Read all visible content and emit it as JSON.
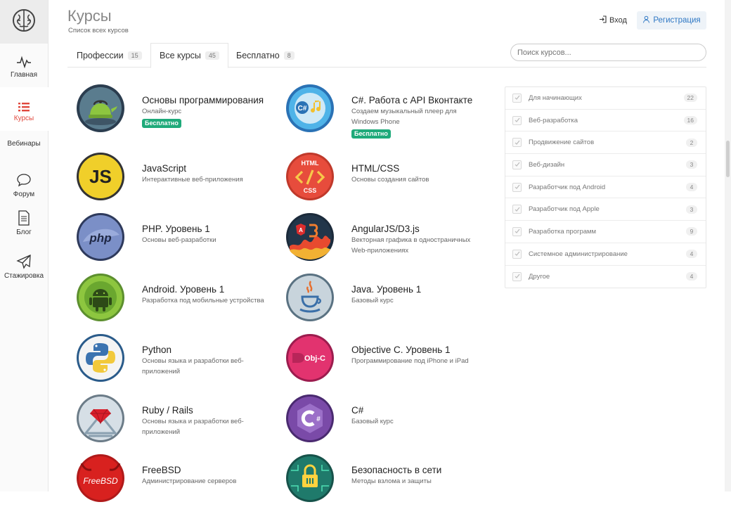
{
  "sidebar": {
    "logo_icon": "brain-icon",
    "items": [
      {
        "icon": "pulse-icon",
        "label": "Главная",
        "active": false
      },
      {
        "icon": "list-icon",
        "label": "Курсы",
        "active": true
      },
      {
        "icon": "",
        "label": "Вебинары",
        "active": false
      },
      {
        "icon": "chat-bubble-icon",
        "label": "Форум",
        "active": false
      },
      {
        "icon": "document-icon",
        "label": "Блог",
        "active": false
      },
      {
        "icon": "paper-plane-icon",
        "label": "Стажировка",
        "active": false
      }
    ]
  },
  "header": {
    "title": "Курсы",
    "subtitle": "Список всех курсов",
    "login_label": "Вход",
    "register_label": "Регистрация"
  },
  "tabs": [
    {
      "label": "Профессии",
      "count": "15",
      "active": false
    },
    {
      "label": "Все курсы",
      "count": "45",
      "active": true
    },
    {
      "label": "Бесплатно",
      "count": "8",
      "active": false
    }
  ],
  "search": {
    "placeholder": "Поиск курсов..."
  },
  "courses": [
    {
      "name": "Основы программирования",
      "desc": "Онлайн-курс",
      "free": "Бесплатно",
      "icon": "kettle-icon"
    },
    {
      "name": "C#. Работа с API Вконтакте",
      "desc": "Создаем музыкальный плеер для Windows Phone",
      "free": "Бесплатно",
      "icon": "music-note-icon"
    },
    {
      "name": "JavaScript",
      "desc": "Интерактивные веб-приложения",
      "icon": "js-logo-icon",
      "logo_text": "JS"
    },
    {
      "name": "HTML/CSS",
      "desc": "Основы создания сайтов",
      "icon": "html-css-icon",
      "logo_text": "HTML",
      "logo_text2": "CSS"
    },
    {
      "name": "PHP. Уровень 1",
      "desc": "Основы веб-разработки",
      "icon": "php-logo-icon",
      "logo_text": "php"
    },
    {
      "name": "AngularJS/D3.js",
      "desc": "Векторная графика в одностраничных Web-приложениях",
      "icon": "angular-d3-icon"
    },
    {
      "name": "Android. Уровень 1",
      "desc": "Разработка под мобильные устройства",
      "icon": "android-icon"
    },
    {
      "name": "Java. Уровень 1",
      "desc": "Базовый курс",
      "icon": "java-cup-icon"
    },
    {
      "name": "Python",
      "desc": "Основы языка и разработки веб-приложений",
      "icon": "python-logo-icon"
    },
    {
      "name": "Objective C. Уровень 1",
      "desc": "Программирование под iPhone и iPad",
      "icon": "objc-apple-icon",
      "logo_text": "Obj-C"
    },
    {
      "name": "Ruby / Rails",
      "desc": "Основы языка и разработки веб-приложений",
      "icon": "ruby-gem-icon"
    },
    {
      "name": "C#",
      "desc": "Базовый курс",
      "icon": "csharp-logo-icon"
    },
    {
      "name": "FreeBSD",
      "desc": "Администрирование серверов",
      "icon": "freebsd-devil-icon",
      "logo_text": "FreeBSD"
    },
    {
      "name": "Безопасность в сети",
      "desc": "Методы взлома и защиты",
      "icon": "lock-circuit-icon"
    }
  ],
  "filters": [
    {
      "label": "Для начинающих",
      "count": "22"
    },
    {
      "label": "Веб-разработка",
      "count": "16"
    },
    {
      "label": "Продвижение сайтов",
      "count": "2"
    },
    {
      "label": "Веб-дизайн",
      "count": "3"
    },
    {
      "label": "Разработчик под Android",
      "count": "4"
    },
    {
      "label": "Разработчик под Apple",
      "count": "3"
    },
    {
      "label": "Разработка программ",
      "count": "9"
    },
    {
      "label": "Системное администрирование",
      "count": "4"
    },
    {
      "label": "Другое",
      "count": "4"
    }
  ],
  "colors": {
    "accent": "#e0483d",
    "link": "#2f78c4",
    "free_badge": "#1faa7a"
  }
}
